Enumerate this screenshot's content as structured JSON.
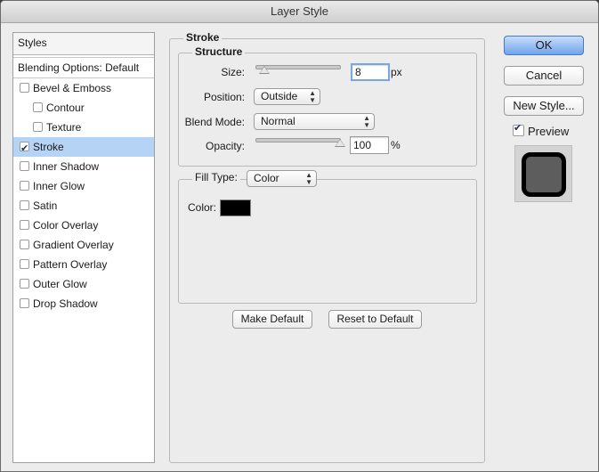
{
  "window": {
    "title": "Layer Style"
  },
  "styles_panel": {
    "header": "Styles",
    "blending_options": "Blending Options: Default",
    "items": [
      {
        "label": "Bevel & Emboss",
        "checked": false,
        "sub": false,
        "selected": false
      },
      {
        "label": "Contour",
        "checked": false,
        "sub": true,
        "selected": false
      },
      {
        "label": "Texture",
        "checked": false,
        "sub": true,
        "selected": false
      },
      {
        "label": "Stroke",
        "checked": true,
        "sub": false,
        "selected": true
      },
      {
        "label": "Inner Shadow",
        "checked": false,
        "sub": false,
        "selected": false
      },
      {
        "label": "Inner Glow",
        "checked": false,
        "sub": false,
        "selected": false
      },
      {
        "label": "Satin",
        "checked": false,
        "sub": false,
        "selected": false
      },
      {
        "label": "Color Overlay",
        "checked": false,
        "sub": false,
        "selected": false
      },
      {
        "label": "Gradient Overlay",
        "checked": false,
        "sub": false,
        "selected": false
      },
      {
        "label": "Pattern Overlay",
        "checked": false,
        "sub": false,
        "selected": false
      },
      {
        "label": "Outer Glow",
        "checked": false,
        "sub": false,
        "selected": false
      },
      {
        "label": "Drop Shadow",
        "checked": false,
        "sub": false,
        "selected": false
      }
    ]
  },
  "stroke": {
    "group_title": "Stroke",
    "structure_title": "Structure",
    "size_label": "Size:",
    "size_value": "8",
    "size_unit": "px",
    "size_slider_fraction": 0.03,
    "position_label": "Position:",
    "position_value": "Outside",
    "blend_label": "Blend Mode:",
    "blend_value": "Normal",
    "opacity_label": "Opacity:",
    "opacity_value": "100",
    "opacity_unit": "%",
    "opacity_slider_fraction": 1.0,
    "fill_type_label": "Fill Type:",
    "fill_type_value": "Color",
    "color_label": "Color:",
    "color_value": "#000000",
    "make_default": "Make Default",
    "reset_default": "Reset to Default"
  },
  "actions": {
    "ok": "OK",
    "cancel": "Cancel",
    "new_style": "New Style...",
    "preview_label": "Preview",
    "preview_checked": true
  },
  "colors": {
    "selection": "#b5d3f4",
    "default_button": "#6fa4ec"
  }
}
